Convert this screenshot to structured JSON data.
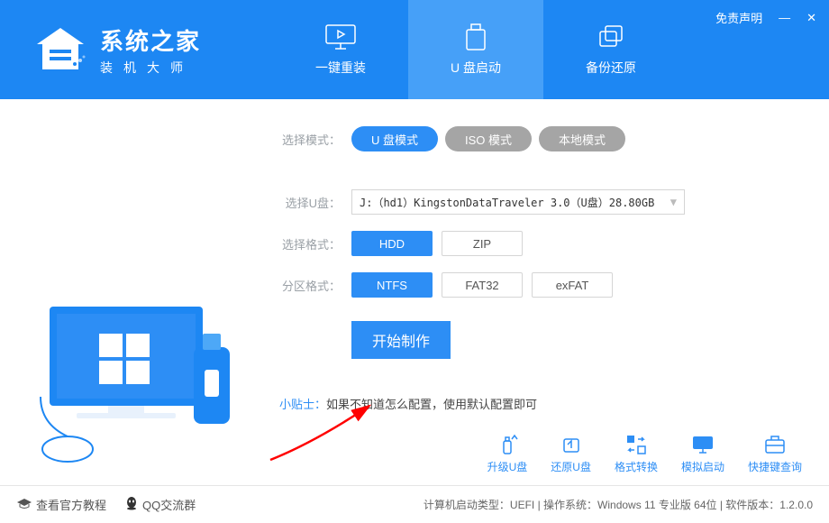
{
  "header": {
    "logo_title": "系统之家",
    "logo_sub": "装机大师",
    "disclaimer": "免责声明",
    "tabs": [
      {
        "label": "一键重装"
      },
      {
        "label": "U 盘启动"
      },
      {
        "label": "备份还原"
      }
    ]
  },
  "mode": {
    "label": "选择模式：",
    "options": [
      {
        "label": "U 盘模式",
        "style": "blue"
      },
      {
        "label": "ISO 模式",
        "style": "grey"
      },
      {
        "label": "本地模式",
        "style": "grey"
      }
    ]
  },
  "udisk": {
    "label": "选择U盘：",
    "value": "J:（hd1）KingstonDataTraveler 3.0（U盘）28.80GB"
  },
  "format": {
    "label": "选择格式：",
    "options": [
      "HDD",
      "ZIP"
    ]
  },
  "partition": {
    "label": "分区格式：",
    "options": [
      "NTFS",
      "FAT32",
      "exFAT"
    ]
  },
  "start_btn": "开始制作",
  "tip": {
    "label": "小贴士：",
    "text": "如果不知道怎么配置，使用默认配置即可"
  },
  "actions": [
    {
      "label": "升级U盘"
    },
    {
      "label": "还原U盘"
    },
    {
      "label": "格式转换"
    },
    {
      "label": "模拟启动"
    },
    {
      "label": "快捷键查询"
    }
  ],
  "footer": {
    "tutorial": "查看官方教程",
    "qq": "QQ交流群",
    "status": "计算机启动类型：UEFI | 操作系统：Windows 11 专业版 64位 | 软件版本：1.2.0.0"
  }
}
